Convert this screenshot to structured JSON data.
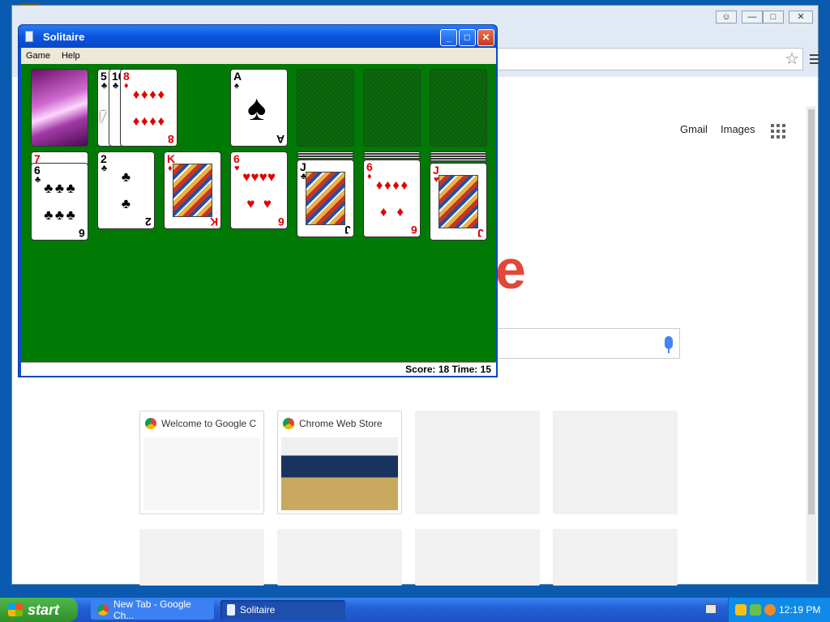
{
  "chrome": {
    "header": {
      "gmail": "Gmail",
      "images": "Images"
    },
    "logo_letter": "e",
    "tiles": [
      {
        "title": "Welcome to Google C"
      },
      {
        "title": "Chrome Web Store"
      }
    ],
    "window_controls": {
      "user": "☺",
      "minimize": "—",
      "maximize": "□",
      "close": "✕"
    }
  },
  "solitaire": {
    "title": "Solitaire",
    "menu": [
      "Game",
      "Help"
    ],
    "status": "Score: 18 Time: 15",
    "title_buttons": {
      "minimize": "_",
      "maximize": "□",
      "close": "✕"
    },
    "stock": {
      "icon": "card-back-icon"
    },
    "waste": [
      {
        "rank": "5",
        "suit": "♣",
        "color": "#000000"
      },
      {
        "rank": "10",
        "suit": "♣",
        "color": "#000000"
      },
      {
        "rank": "8",
        "suit": "♦",
        "color": "#e10000"
      }
    ],
    "foundations": [
      {
        "rank": "A",
        "suit": "♠",
        "color": "#000000"
      }
    ],
    "tableau": [
      {
        "under": {
          "rank": "7",
          "suit": "♥"
        },
        "top": {
          "rank": "6",
          "suit": "♣",
          "color": "#000000"
        }
      },
      {
        "top": {
          "rank": "2",
          "suit": "♣",
          "color": "#000000"
        }
      },
      {
        "top": {
          "rank": "K",
          "suit": "♦",
          "color": "#e10000"
        }
      },
      {
        "top": {
          "rank": "6",
          "suit": "♥",
          "color": "#e10000"
        }
      },
      {
        "top": {
          "rank": "J",
          "suit": "♣",
          "color": "#000000"
        }
      },
      {
        "top": {
          "rank": "6",
          "suit": "♦",
          "color": "#e10000"
        }
      },
      {
        "top": {
          "rank": "J",
          "suit": "♥",
          "color": "#e10000"
        }
      }
    ]
  },
  "taskbar": {
    "start": "start",
    "tasks": [
      "New Tab - Google Ch...",
      "Solitaire"
    ],
    "clock": "12:19 PM"
  },
  "colors": {
    "felt": "#007a05",
    "desktop": "#0a5bb0",
    "accent_red": "#e10000",
    "xp_blue": "#0c50d8"
  }
}
